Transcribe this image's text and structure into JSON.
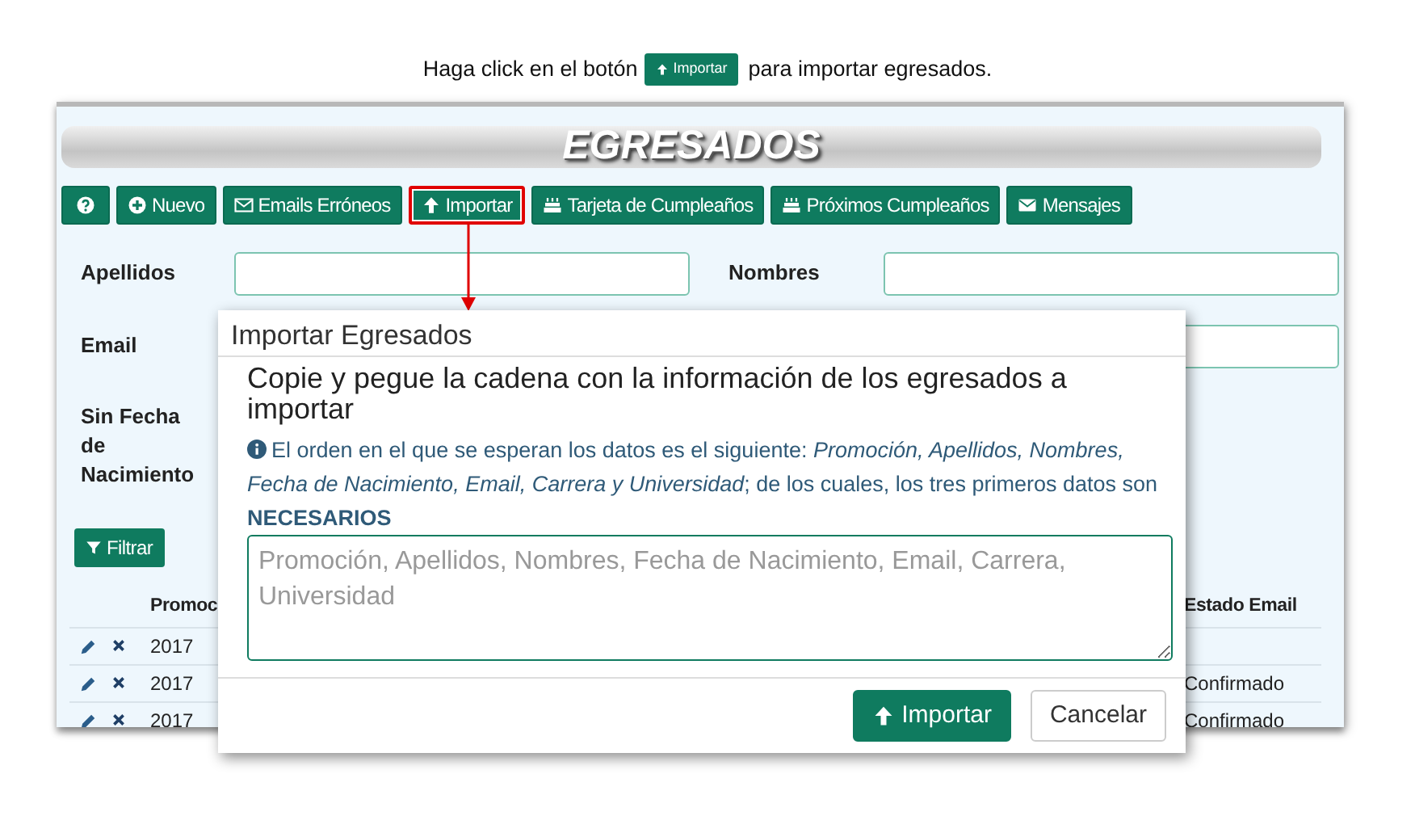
{
  "instruction": {
    "before": "Haga click en el botón",
    "button": "Importar",
    "after": "para importar egresados."
  },
  "app": {
    "title": "EGRESADOS",
    "toolbar": [
      {
        "kind": "help",
        "highlighted": false
      },
      {
        "kind": "plus",
        "label": "Nuevo",
        "highlighted": false
      },
      {
        "kind": "envelope-outline",
        "label": "Emails Erróneos",
        "highlighted": false
      },
      {
        "kind": "upload",
        "label": "Importar",
        "highlighted": true
      },
      {
        "kind": "cake",
        "label": "Tarjeta de Cumpleaños",
        "highlighted": false
      },
      {
        "kind": "cake",
        "label": "Próximos Cumpleaños",
        "highlighted": false
      },
      {
        "kind": "envelope",
        "label": "Mensajes",
        "highlighted": false
      }
    ],
    "filters": [
      {
        "label": "Apellidos",
        "has_field": true
      },
      {
        "label": "Nombres",
        "has_field": true
      },
      {
        "label": "Email",
        "has_field": false
      },
      {
        "has_field": true
      },
      {
        "label": "Sin Fecha de Nacimiento",
        "has_field": false
      }
    ],
    "filter_button": "Filtrar",
    "table": {
      "columns": [
        "Promoc",
        "Estado Email"
      ],
      "rows": [
        {
          "column_1": "2017"
        },
        {
          "column_1": "2017",
          "estado_email": "Confirmado"
        },
        {
          "column_1": "2017",
          "estado_email": "Confirmado"
        }
      ]
    }
  },
  "modal": {
    "title": "Importar Egresados",
    "heading": "Copie y pegue la cadena con la información de los egresados a importar",
    "info": "El orden en el que se esperan los datos es el siguiente: *Promoción, Apellidos, Nombres, Fecha de Nacimiento, Email, Carrera y Universidad*; de los cuales, los tres primeros datos son **NECESARIOS**",
    "placeholder": "Promoción, Apellidos, Nombres, Fecha de Nacimiento, Email, Carrera, Universidad",
    "buttons": [
      {
        "kind": "primary",
        "label": "Importar"
      },
      {
        "kind": "secondary",
        "label": "Cancelar"
      }
    ]
  }
}
